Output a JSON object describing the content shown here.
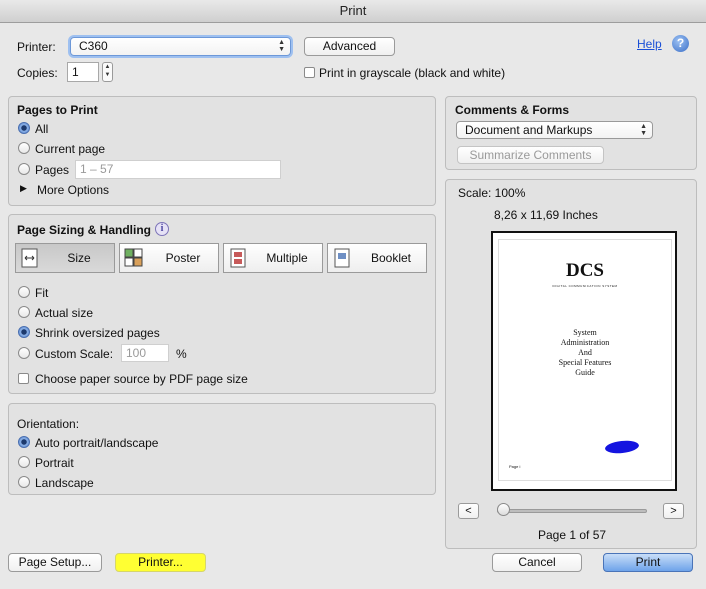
{
  "window": {
    "title": "Print"
  },
  "printer": {
    "label": "Printer:",
    "selected": "C360",
    "advanced_label": "Advanced",
    "help_label": "Help",
    "copies_label": "Copies:",
    "copies_value": "1",
    "grayscale_label": "Print in grayscale (black and white)",
    "grayscale_checked": false
  },
  "pages_to_print": {
    "title": "Pages to Print",
    "options": [
      "All",
      "Current page",
      "Pages"
    ],
    "selected": "All",
    "range_placeholder": "1 – 57",
    "more_options": "More Options"
  },
  "comments_forms": {
    "title": "Comments & Forms",
    "selected": "Document and Markups",
    "summarize_label": "Summarize Comments"
  },
  "sizing": {
    "title": "Page Sizing & Handling",
    "tabs": [
      "Size",
      "Poster",
      "Multiple",
      "Booklet"
    ],
    "selected_tab": "Size",
    "options": [
      "Fit",
      "Actual size",
      "Shrink oversized pages",
      "Custom Scale:"
    ],
    "selected_option": "Shrink oversized pages",
    "custom_scale_placeholder": "100",
    "custom_scale_unit": "%",
    "paper_source_label": "Choose paper source by PDF page size"
  },
  "orientation": {
    "title": "Orientation:",
    "options": [
      "Auto portrait/landscape",
      "Portrait",
      "Landscape"
    ],
    "selected": "Auto portrait/landscape"
  },
  "preview": {
    "scale_label": "Scale: 100%",
    "size_label": "8,26 x 11,69 Inches",
    "doc_title": "DCS",
    "doc_subtitle": "DIGITAL COMMUNICATION SYSTEM",
    "doc_heading_lines": [
      "System",
      "Administration",
      "And",
      "Special Features",
      "Guide"
    ],
    "doc_footer": "Page i",
    "prev_label": "<",
    "next_label": ">",
    "page_indicator": "Page 1 of 57",
    "slider_fraction": 0.0
  },
  "footer": {
    "page_setup_label": "Page Setup...",
    "printer_label": "Printer...",
    "cancel_label": "Cancel",
    "print_label": "Print"
  },
  "colors": {
    "highlight": "#ffff33",
    "accent": "#3b7bd9",
    "help_link": "#1a4fd6"
  }
}
